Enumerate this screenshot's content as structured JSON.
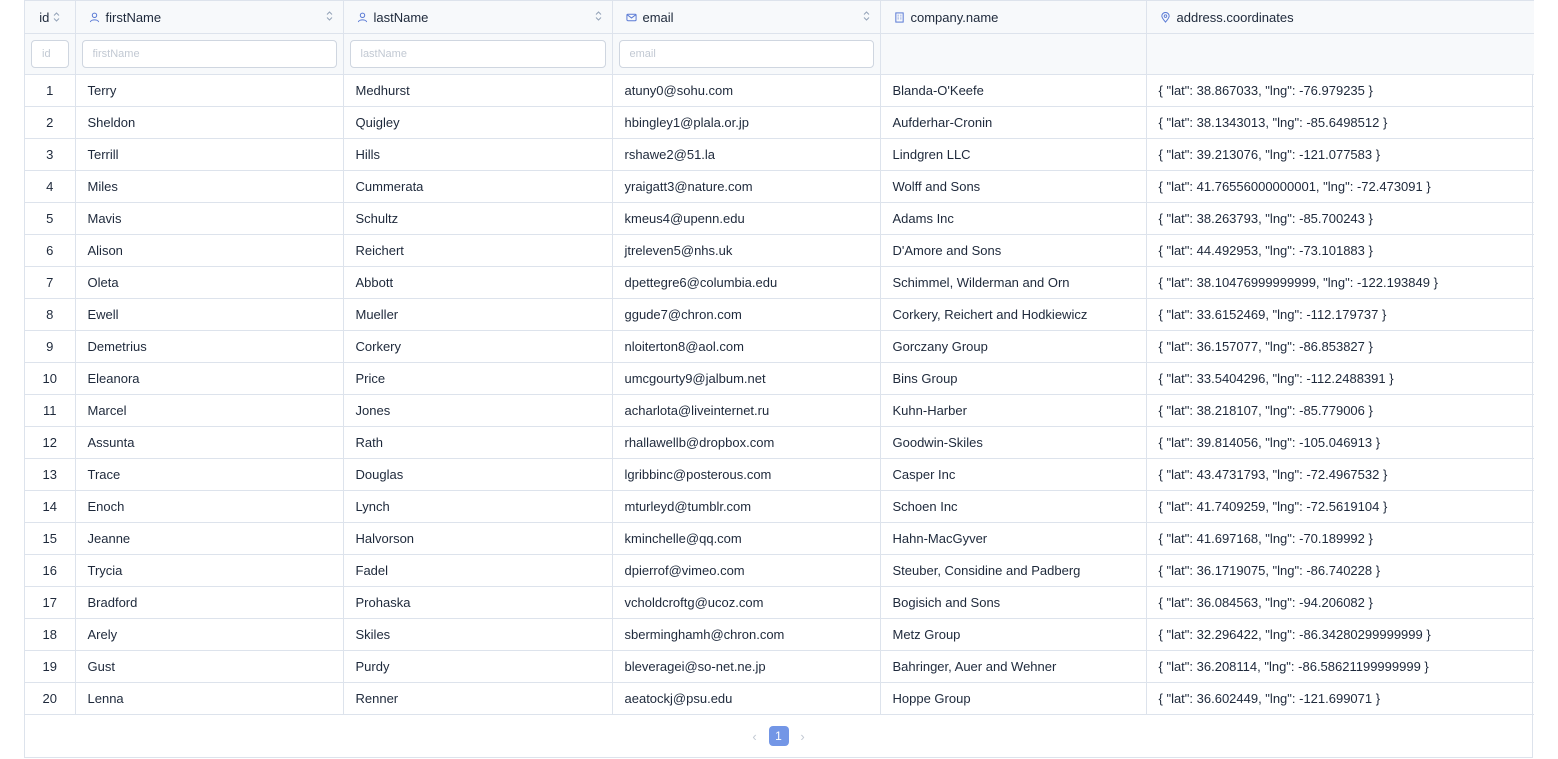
{
  "columns": [
    {
      "label": "id",
      "icon": null
    },
    {
      "label": "firstName",
      "icon": "user-icon"
    },
    {
      "label": "lastName",
      "icon": "user-icon"
    },
    {
      "label": "email",
      "icon": "mail-icon"
    },
    {
      "label": "company.name",
      "icon": "building-icon"
    },
    {
      "label": "address.coordinates",
      "icon": "map-pin-icon"
    }
  ],
  "filters": {
    "id_placeholder": "id",
    "firstName_placeholder": "firstName",
    "lastName_placeholder": "lastName",
    "email_placeholder": "email"
  },
  "rows": [
    [
      "1",
      "Terry",
      "Medhurst",
      "atuny0@sohu.com",
      "Blanda-O'Keefe",
      "{ \"lat\": 38.867033, \"lng\": -76.979235 }"
    ],
    [
      "2",
      "Sheldon",
      "Quigley",
      "hbingley1@plala.or.jp",
      "Aufderhar-Cronin",
      "{ \"lat\": 38.1343013, \"lng\": -85.6498512 }"
    ],
    [
      "3",
      "Terrill",
      "Hills",
      "rshawe2@51.la",
      "Lindgren LLC",
      "{ \"lat\": 39.213076, \"lng\": -121.077583 }"
    ],
    [
      "4",
      "Miles",
      "Cummerata",
      "yraigatt3@nature.com",
      "Wolff and Sons",
      "{ \"lat\": 41.76556000000001, \"lng\": -72.473091 }"
    ],
    [
      "5",
      "Mavis",
      "Schultz",
      "kmeus4@upenn.edu",
      "Adams Inc",
      "{ \"lat\": 38.263793, \"lng\": -85.700243 }"
    ],
    [
      "6",
      "Alison",
      "Reichert",
      "jtreleven5@nhs.uk",
      "D'Amore and Sons",
      "{ \"lat\": 44.492953, \"lng\": -73.101883 }"
    ],
    [
      "7",
      "Oleta",
      "Abbott",
      "dpettegre6@columbia.edu",
      "Schimmel, Wilderman and Orn",
      "{ \"lat\": 38.10476999999999, \"lng\": -122.193849 }"
    ],
    [
      "8",
      "Ewell",
      "Mueller",
      "ggude7@chron.com",
      "Corkery, Reichert and Hodkiewicz",
      "{ \"lat\": 33.6152469, \"lng\": -112.179737 }"
    ],
    [
      "9",
      "Demetrius",
      "Corkery",
      "nloiterton8@aol.com",
      "Gorczany Group",
      "{ \"lat\": 36.157077, \"lng\": -86.853827 }"
    ],
    [
      "10",
      "Eleanora",
      "Price",
      "umcgourty9@jalbum.net",
      "Bins Group",
      "{ \"lat\": 33.5404296, \"lng\": -112.2488391 }"
    ],
    [
      "11",
      "Marcel",
      "Jones",
      "acharlota@liveinternet.ru",
      "Kuhn-Harber",
      "{ \"lat\": 38.218107, \"lng\": -85.779006 }"
    ],
    [
      "12",
      "Assunta",
      "Rath",
      "rhallawellb@dropbox.com",
      "Goodwin-Skiles",
      "{ \"lat\": 39.814056, \"lng\": -105.046913 }"
    ],
    [
      "13",
      "Trace",
      "Douglas",
      "lgribbinc@posterous.com",
      "Casper Inc",
      "{ \"lat\": 43.4731793, \"lng\": -72.4967532 }"
    ],
    [
      "14",
      "Enoch",
      "Lynch",
      "mturleyd@tumblr.com",
      "Schoen Inc",
      "{ \"lat\": 41.7409259, \"lng\": -72.5619104 }"
    ],
    [
      "15",
      "Jeanne",
      "Halvorson",
      "kminchelle@qq.com",
      "Hahn-MacGyver",
      "{ \"lat\": 41.697168, \"lng\": -70.189992 }"
    ],
    [
      "16",
      "Trycia",
      "Fadel",
      "dpierrof@vimeo.com",
      "Steuber, Considine and Padberg",
      "{ \"lat\": 36.1719075, \"lng\": -86.740228 }"
    ],
    [
      "17",
      "Bradford",
      "Prohaska",
      "vcholdcroftg@ucoz.com",
      "Bogisich and Sons",
      "{ \"lat\": 36.084563, \"lng\": -94.206082 }"
    ],
    [
      "18",
      "Arely",
      "Skiles",
      "sberminghamh@chron.com",
      "Metz Group",
      "{ \"lat\": 32.296422, \"lng\": -86.34280299999999 }"
    ],
    [
      "19",
      "Gust",
      "Purdy",
      "bleveragei@so-net.ne.jp",
      "Bahringer, Auer and Wehner",
      "{ \"lat\": 36.208114, \"lng\": -86.58621199999999 }"
    ],
    [
      "20",
      "Lenna",
      "Renner",
      "aeatockj@psu.edu",
      "Hoppe Group",
      "{ \"lat\": 36.602449, \"lng\": -121.699071 }"
    ]
  ],
  "pagination": {
    "prev_icon": "chevron-left-icon",
    "next_icon": "chevron-right-icon",
    "current_page": "1"
  },
  "colors": {
    "accent": "#7396e6",
    "icon": "#5b7bd5",
    "border": "#dde3ec",
    "header_bg": "#f7f9fb"
  }
}
